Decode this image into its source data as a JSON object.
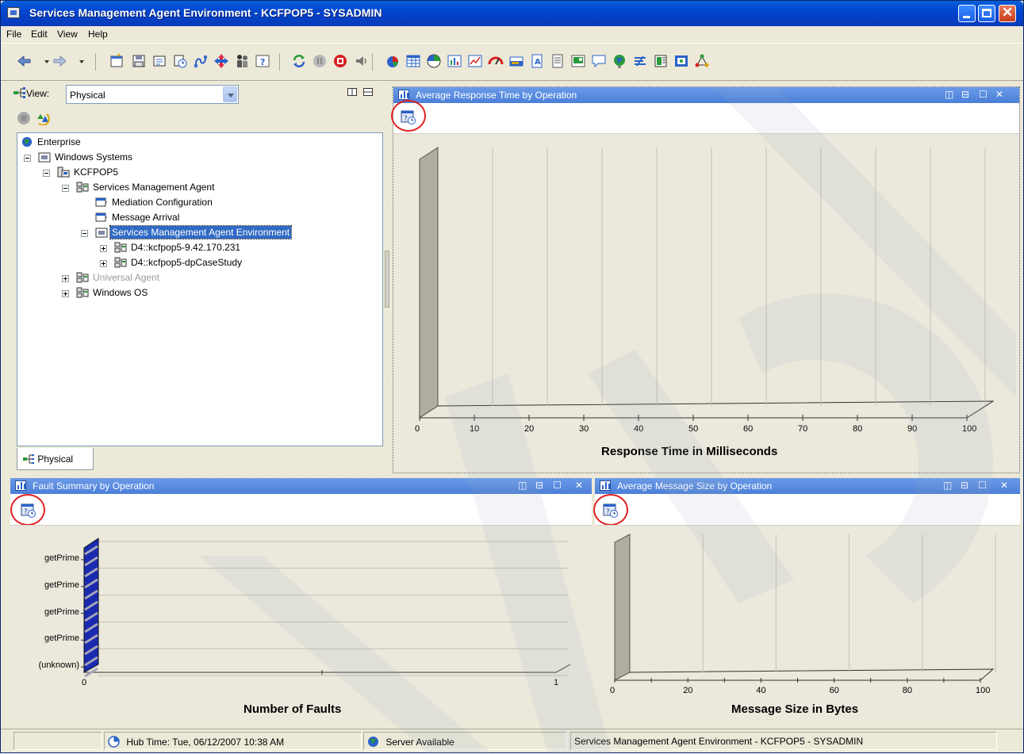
{
  "window": {
    "title": "Services Management Agent Environment - KCFPOP5 - SYSADMIN"
  },
  "menu": [
    "File",
    "Edit",
    "View",
    "Help"
  ],
  "navigator": {
    "view_label": "View:",
    "view_value": "Physical",
    "tab_label": "Physical",
    "tree": [
      {
        "label": "Enterprise",
        "icon": "globe-icon"
      },
      {
        "label": "Windows Systems",
        "icon": "folder-icon"
      },
      {
        "label": "KCFPOP5",
        "icon": "computer-icon"
      },
      {
        "label": "Services Management Agent",
        "icon": "agent-icon"
      },
      {
        "label": "Mediation Configuration",
        "icon": "workspace-icon"
      },
      {
        "label": "Message Arrival",
        "icon": "workspace-icon"
      },
      {
        "label": "Services Management Agent Environment",
        "icon": "folder-icon"
      },
      {
        "label": "D4::kcfpop5-9.42.170.231",
        "icon": "agent-icon"
      },
      {
        "label": "D4::kcfpop5-dpCaseStudy",
        "icon": "agent-icon"
      },
      {
        "label": "Universal Agent",
        "icon": "agent-icon"
      },
      {
        "label": "Windows OS",
        "icon": "agent-icon"
      }
    ]
  },
  "panels": {
    "response": {
      "title": "Average Response Time by Operation",
      "xlabel": "Response Time in Milliseconds",
      "ticks": [
        "0",
        "10",
        "20",
        "30",
        "40",
        "50",
        "60",
        "70",
        "80",
        "90",
        "100"
      ]
    },
    "faults": {
      "title": "Fault Summary by Operation",
      "xlabel": "Number of Faults",
      "xticks": [
        "0",
        "1"
      ],
      "categories": [
        "getPrime",
        "getPrime",
        "getPrime",
        "getPrime",
        "(unknown)"
      ]
    },
    "msgsize": {
      "title": "Average Message Size by Operation",
      "xlabel": "Message Size in Bytes",
      "ticks": [
        "0",
        "20",
        "40",
        "60",
        "80",
        "100"
      ]
    }
  },
  "status": {
    "hub_time": "Hub Time: Tue, 06/12/2007 10:38 AM",
    "server": "Server Available",
    "context": "Services Management Agent Environment - KCFPOP5 - SYSADMIN"
  },
  "colors": {
    "titlebar": "#0045d0",
    "panel_title": "#5a8ee0",
    "chart_bg": "#ebe8dc",
    "highlight_ring": "#e02020",
    "fault_bar": "#1a2bb0"
  }
}
